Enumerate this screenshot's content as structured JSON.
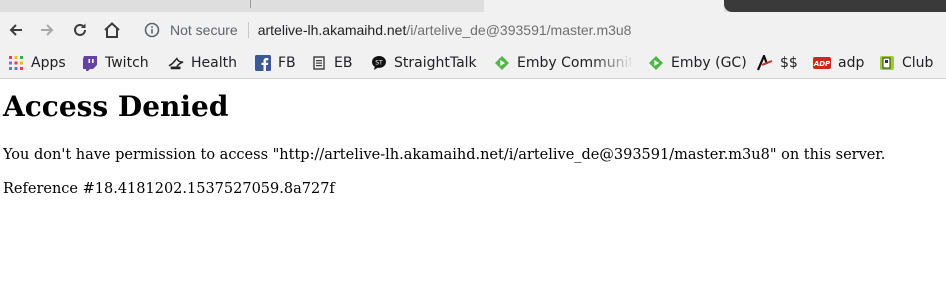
{
  "browser": {
    "address_bar": {
      "security_label": "Not secure",
      "url_host": "artelive-lh.akamaihd.net",
      "url_path": "/i/artelive_de@393591/master.m3u8"
    },
    "bookmarks": [
      {
        "label": "Apps",
        "icon": "apps-grid-icon"
      },
      {
        "label": "Twitch",
        "icon": "twitch-icon"
      },
      {
        "label": "Health",
        "icon": "health-icon"
      },
      {
        "label": "FB",
        "icon": "facebook-icon"
      },
      {
        "label": "EB",
        "icon": "document-icon"
      },
      {
        "label": "StraightTalk",
        "icon": "straighttalk-icon"
      },
      {
        "label": "Emby Communit",
        "icon": "emby-icon"
      },
      {
        "label": "Emby (GC)",
        "icon": "emby-icon"
      },
      {
        "label": "$$",
        "icon": "dollar-site-icon"
      },
      {
        "label": "adp",
        "icon": "adp-icon"
      },
      {
        "label": "Club",
        "icon": "club-icon"
      }
    ]
  },
  "page": {
    "heading": "Access Denied",
    "message": "You don't have permission to access \"http://artelive-lh.akamaihd.net/i/artelive_de@393591/master.m3u8\" on this server.",
    "reference": "Reference #18.4181202.1537527059.8a727f"
  },
  "colors": {
    "toolbar_bg": "#f1f1f1",
    "tabstrip_bg": "#dedede",
    "emby_green": "#52b54b",
    "twitch_purple": "#6441a5",
    "facebook_blue": "#3b5998",
    "adp_red": "#d0271d"
  }
}
